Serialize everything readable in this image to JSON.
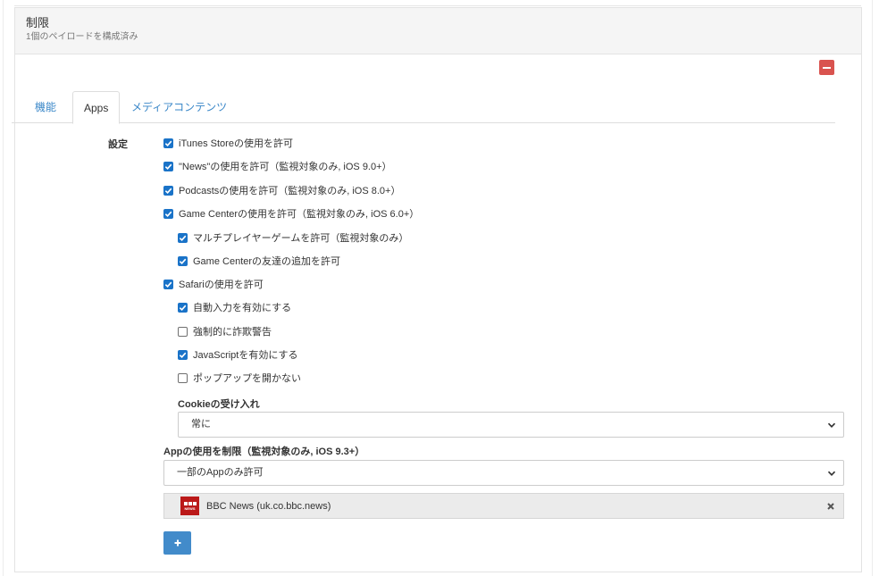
{
  "header": {
    "title": "制限",
    "subtitle": "1個のペイロードを構成済み"
  },
  "tabs": [
    {
      "label": "機能",
      "active": false
    },
    {
      "label": "Apps",
      "active": true
    },
    {
      "label": "メディアコンテンツ",
      "active": false
    }
  ],
  "settings": {
    "label": "設定",
    "options": [
      {
        "label": "iTunes Storeの使用を許可",
        "checked": true
      },
      {
        "label": "\"News\"の使用を許可（監視対象のみ, iOS 9.0+）",
        "checked": true
      },
      {
        "label": "Podcastsの使用を許可（監視対象のみ, iOS 8.0+）",
        "checked": true
      },
      {
        "label": "Game Centerの使用を許可（監視対象のみ, iOS 6.0+）",
        "checked": true
      },
      {
        "label": "マルチプレイヤーゲームを許可（監視対象のみ）",
        "checked": true
      },
      {
        "label": "Game Centerの友達の追加を許可",
        "checked": true
      },
      {
        "label": "Safariの使用を許可",
        "checked": true
      },
      {
        "label": "自動入力を有効にする",
        "checked": true
      },
      {
        "label": "強制的に詐欺警告",
        "checked": false
      },
      {
        "label": "JavaScriptを有効にする",
        "checked": true
      },
      {
        "label": "ポップアップを開かない",
        "checked": false
      }
    ]
  },
  "cookies": {
    "label": "Cookieの受け入れ",
    "value": "常に"
  },
  "app_restriction": {
    "label": "Appの使用を制限（監視対象のみ, iOS 9.3+）",
    "value": "一部のAppのみ許可"
  },
  "allowed_apps": [
    {
      "name": "BBC News (uk.co.bbc.news)",
      "icon": "bbc-news-icon"
    }
  ],
  "colors": {
    "checkbox": "#1a73c8",
    "remove_button": "#d9534f",
    "add_button": "#428bca",
    "tab_link": "#3a87c8"
  }
}
